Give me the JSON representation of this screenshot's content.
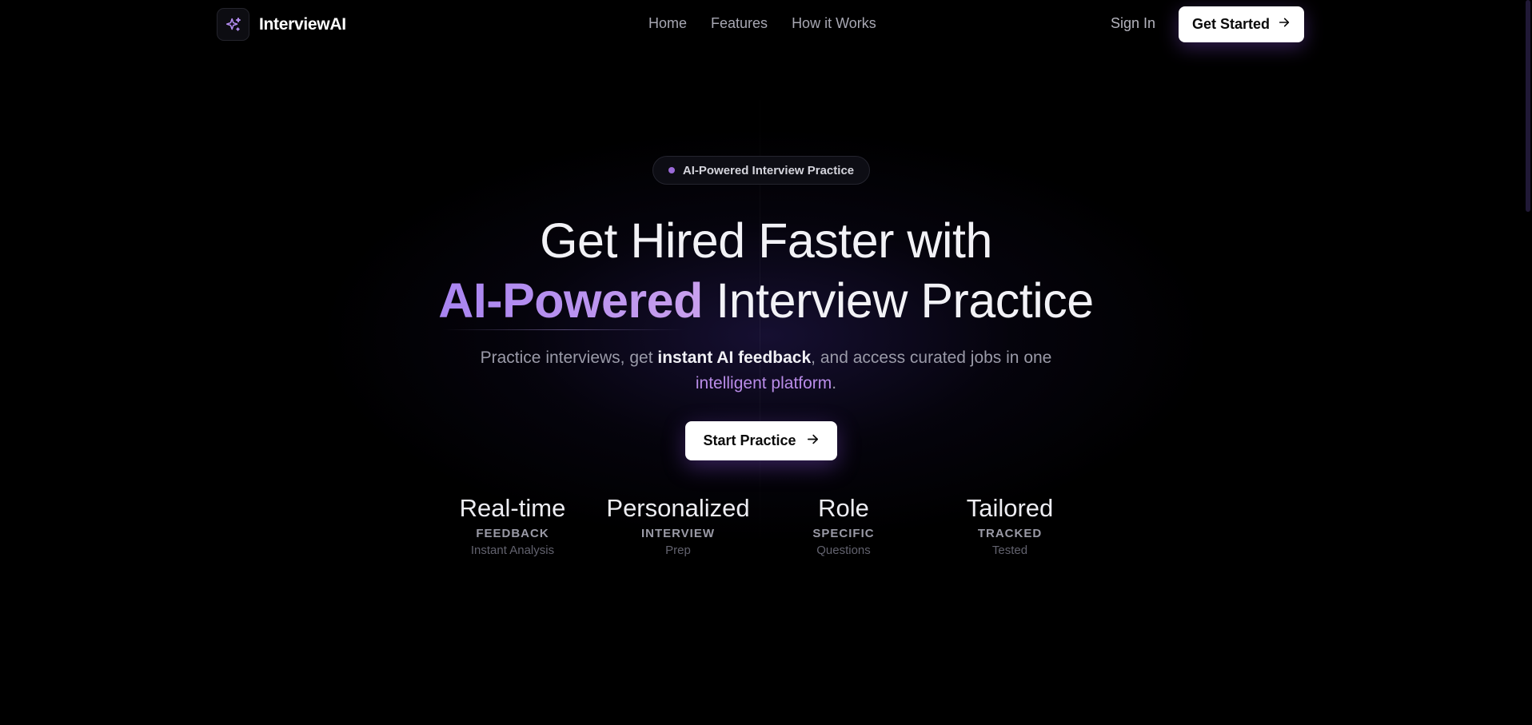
{
  "nav": {
    "brand": "InterviewAI",
    "links": [
      "Home",
      "Features",
      "How it Works"
    ],
    "sign_in": "Sign In",
    "get_started": "Get Started"
  },
  "hero": {
    "badge": "AI-Powered Interview Practice",
    "headline_line1": "Get Hired Faster with",
    "headline_accent": "AI-Powered",
    "headline_line2_rest": " Interview Practice",
    "subtitle_part1": "Practice interviews, get ",
    "subtitle_bold": "instant AI feedback",
    "subtitle_part2": ", and access curated jobs in one ",
    "subtitle_accent": "intelligent platform",
    "subtitle_end": ".",
    "cta": "Start Practice"
  },
  "stats": [
    {
      "title": "Real-time",
      "label": "FEEDBACK",
      "desc": "Instant Analysis"
    },
    {
      "title": "Personalized",
      "label": "INTERVIEW",
      "desc": "Prep"
    },
    {
      "title": "Role",
      "label": "SPECIFIC",
      "desc": "Questions"
    },
    {
      "title": "Tailored",
      "label": "TRACKED",
      "desc": "Tested"
    }
  ],
  "colors": {
    "background": "#000000",
    "accent": "#b98ce8",
    "button_bg": "#ffffff"
  },
  "icons": {
    "logo": "sparkles-icon",
    "arrow": "arrow-right-icon"
  }
}
